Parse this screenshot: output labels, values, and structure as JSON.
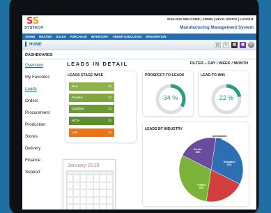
{
  "header": {
    "logo_text": "SYSTECH",
    "top_links": "2019-2020  WELCOME | ADMIN | HEAD OFFICE | LOGOUT",
    "system_title": "Manufacturing Management System"
  },
  "menu": [
    "ADMIN",
    "MASTER",
    "SALES",
    "PURCHASE",
    "INVENTORY",
    "ORDER EXECUTION",
    "INTEGRATION"
  ],
  "toolbar": {
    "home_label": "HOME"
  },
  "dashboards_label": "DASHBOARDS",
  "sidebar": {
    "items": [
      {
        "label": "Overview",
        "active": false,
        "link": true
      },
      {
        "label": "My Favorites",
        "active": false,
        "link": false
      },
      {
        "label": "Leads",
        "active": true,
        "link": true
      },
      {
        "label": "Orders",
        "active": false,
        "link": false
      },
      {
        "label": "Procurement",
        "active": false,
        "link": false
      },
      {
        "label": "Production",
        "active": false,
        "link": false
      },
      {
        "label": "Stores",
        "active": false,
        "link": false
      },
      {
        "label": "Delivery",
        "active": false,
        "link": false
      },
      {
        "label": "Finance",
        "active": false,
        "link": false
      },
      {
        "label": "Support",
        "active": false,
        "link": false
      }
    ]
  },
  "main": {
    "title": "LEADS IN DETAIL",
    "filter_title": "FILTER – DAY / WEEK / MONTH"
  },
  "stages": {
    "title": "LEADS STAGE WISE",
    "rows": [
      {
        "label": "New",
        "value": "35",
        "color": "#8db24a"
      },
      {
        "label": "Pipeline",
        "value": "33",
        "color": "#7ea73f"
      },
      {
        "label": "Qualified",
        "value": "33",
        "color": "#6c9a36"
      },
      {
        "label": "WON",
        "value": "25",
        "color": "#5d8e2e"
      },
      {
        "label": "Lost",
        "value": "22",
        "color": "#e8751a"
      }
    ]
  },
  "prospect": {
    "title": "PROSPECT-TO-LEADS",
    "percent": 34,
    "label": "34 %"
  },
  "lead_to_win": {
    "title": "LEAD-TO-WIN",
    "percent": 22,
    "label": "22 %"
  },
  "industry": {
    "title": "LEADS BY INDUSTRY",
    "segments": [
      {
        "name": "Automobiles",
        "pct": "30%",
        "value": 30,
        "color": "#2d6fb5"
      },
      {
        "name": "Education",
        "pct": "20%",
        "value": 20,
        "color": "#d33e3e"
      },
      {
        "name": "Textiles",
        "pct": "30%",
        "value": 30,
        "color": "#7bb33a"
      },
      {
        "name": "Service",
        "pct": "20%",
        "value": 20,
        "color": "#6a4c9c"
      }
    ]
  },
  "calendar": {
    "title": "January 2019"
  },
  "colors": {
    "accent": "#2a6bb0",
    "gauge": "#2a9d7c"
  }
}
